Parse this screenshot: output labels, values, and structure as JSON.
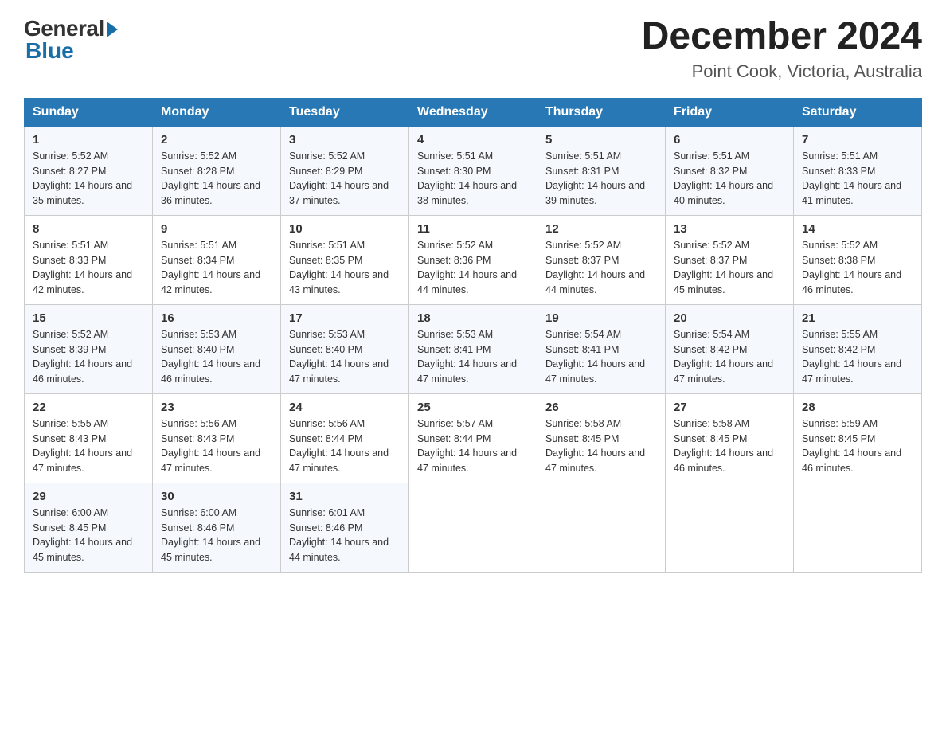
{
  "logo": {
    "general": "General",
    "blue": "Blue"
  },
  "title": {
    "month_year": "December 2024",
    "location": "Point Cook, Victoria, Australia"
  },
  "headers": [
    "Sunday",
    "Monday",
    "Tuesday",
    "Wednesday",
    "Thursday",
    "Friday",
    "Saturday"
  ],
  "weeks": [
    [
      {
        "day": "1",
        "sunrise": "5:52 AM",
        "sunset": "8:27 PM",
        "daylight": "14 hours and 35 minutes."
      },
      {
        "day": "2",
        "sunrise": "5:52 AM",
        "sunset": "8:28 PM",
        "daylight": "14 hours and 36 minutes."
      },
      {
        "day": "3",
        "sunrise": "5:52 AM",
        "sunset": "8:29 PM",
        "daylight": "14 hours and 37 minutes."
      },
      {
        "day": "4",
        "sunrise": "5:51 AM",
        "sunset": "8:30 PM",
        "daylight": "14 hours and 38 minutes."
      },
      {
        "day": "5",
        "sunrise": "5:51 AM",
        "sunset": "8:31 PM",
        "daylight": "14 hours and 39 minutes."
      },
      {
        "day": "6",
        "sunrise": "5:51 AM",
        "sunset": "8:32 PM",
        "daylight": "14 hours and 40 minutes."
      },
      {
        "day": "7",
        "sunrise": "5:51 AM",
        "sunset": "8:33 PM",
        "daylight": "14 hours and 41 minutes."
      }
    ],
    [
      {
        "day": "8",
        "sunrise": "5:51 AM",
        "sunset": "8:33 PM",
        "daylight": "14 hours and 42 minutes."
      },
      {
        "day": "9",
        "sunrise": "5:51 AM",
        "sunset": "8:34 PM",
        "daylight": "14 hours and 42 minutes."
      },
      {
        "day": "10",
        "sunrise": "5:51 AM",
        "sunset": "8:35 PM",
        "daylight": "14 hours and 43 minutes."
      },
      {
        "day": "11",
        "sunrise": "5:52 AM",
        "sunset": "8:36 PM",
        "daylight": "14 hours and 44 minutes."
      },
      {
        "day": "12",
        "sunrise": "5:52 AM",
        "sunset": "8:37 PM",
        "daylight": "14 hours and 44 minutes."
      },
      {
        "day": "13",
        "sunrise": "5:52 AM",
        "sunset": "8:37 PM",
        "daylight": "14 hours and 45 minutes."
      },
      {
        "day": "14",
        "sunrise": "5:52 AM",
        "sunset": "8:38 PM",
        "daylight": "14 hours and 46 minutes."
      }
    ],
    [
      {
        "day": "15",
        "sunrise": "5:52 AM",
        "sunset": "8:39 PM",
        "daylight": "14 hours and 46 minutes."
      },
      {
        "day": "16",
        "sunrise": "5:53 AM",
        "sunset": "8:40 PM",
        "daylight": "14 hours and 46 minutes."
      },
      {
        "day": "17",
        "sunrise": "5:53 AM",
        "sunset": "8:40 PM",
        "daylight": "14 hours and 47 minutes."
      },
      {
        "day": "18",
        "sunrise": "5:53 AM",
        "sunset": "8:41 PM",
        "daylight": "14 hours and 47 minutes."
      },
      {
        "day": "19",
        "sunrise": "5:54 AM",
        "sunset": "8:41 PM",
        "daylight": "14 hours and 47 minutes."
      },
      {
        "day": "20",
        "sunrise": "5:54 AM",
        "sunset": "8:42 PM",
        "daylight": "14 hours and 47 minutes."
      },
      {
        "day": "21",
        "sunrise": "5:55 AM",
        "sunset": "8:42 PM",
        "daylight": "14 hours and 47 minutes."
      }
    ],
    [
      {
        "day": "22",
        "sunrise": "5:55 AM",
        "sunset": "8:43 PM",
        "daylight": "14 hours and 47 minutes."
      },
      {
        "day": "23",
        "sunrise": "5:56 AM",
        "sunset": "8:43 PM",
        "daylight": "14 hours and 47 minutes."
      },
      {
        "day": "24",
        "sunrise": "5:56 AM",
        "sunset": "8:44 PM",
        "daylight": "14 hours and 47 minutes."
      },
      {
        "day": "25",
        "sunrise": "5:57 AM",
        "sunset": "8:44 PM",
        "daylight": "14 hours and 47 minutes."
      },
      {
        "day": "26",
        "sunrise": "5:58 AM",
        "sunset": "8:45 PM",
        "daylight": "14 hours and 47 minutes."
      },
      {
        "day": "27",
        "sunrise": "5:58 AM",
        "sunset": "8:45 PM",
        "daylight": "14 hours and 46 minutes."
      },
      {
        "day": "28",
        "sunrise": "5:59 AM",
        "sunset": "8:45 PM",
        "daylight": "14 hours and 46 minutes."
      }
    ],
    [
      {
        "day": "29",
        "sunrise": "6:00 AM",
        "sunset": "8:45 PM",
        "daylight": "14 hours and 45 minutes."
      },
      {
        "day": "30",
        "sunrise": "6:00 AM",
        "sunset": "8:46 PM",
        "daylight": "14 hours and 45 minutes."
      },
      {
        "day": "31",
        "sunrise": "6:01 AM",
        "sunset": "8:46 PM",
        "daylight": "14 hours and 44 minutes."
      },
      null,
      null,
      null,
      null
    ]
  ]
}
